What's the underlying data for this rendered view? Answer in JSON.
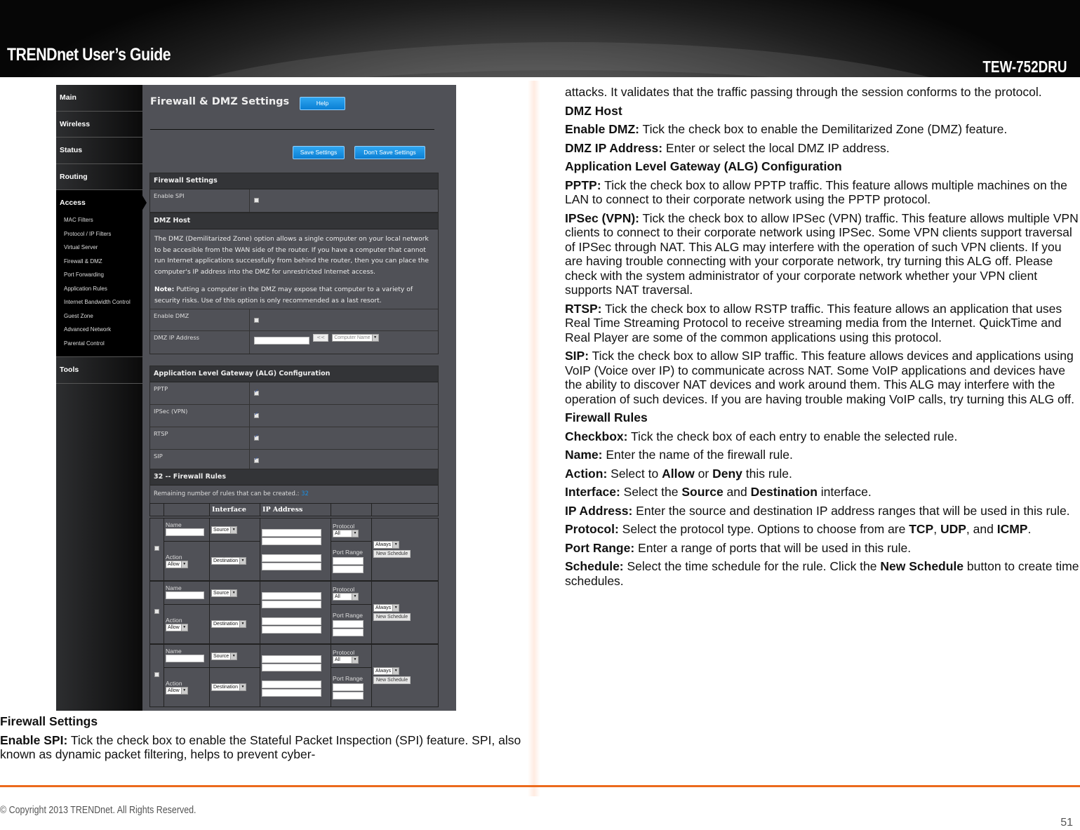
{
  "header": {
    "guide_title": "TRENDnet User’s Guide",
    "model": "TEW-752DRU"
  },
  "router_ui": {
    "sidebar": {
      "items": [
        "Main",
        "Wireless",
        "Status",
        "Routing"
      ],
      "active_section": "Access",
      "sub_items": [
        "MAC Filters",
        "Protocol / IP Filters",
        "Virtual Server",
        "Firewall & DMZ",
        "Port Forwarding",
        "Application Rules",
        "Internet Bandwidth Control",
        "Guest Zone",
        "Advanced Network",
        "Parental Control"
      ],
      "last_item": "Tools"
    },
    "page_title": "Firewall & DMZ Settings",
    "help_label": "Help",
    "save_label": "Save Settings",
    "dont_save_label": "Don't Save Settings",
    "firewall_settings": {
      "heading": "Firewall Settings",
      "enable_spi_label": "Enable SPI",
      "enable_spi_checked": false
    },
    "dmz_host": {
      "heading": "DMZ Host",
      "description": "The DMZ (Demilitarized Zone) option allows a single computer on your local network to be accesible from the WAN side of the router. If you have a computer that cannot run Internet applications successfully from behind the router, then you can place the computer's IP address into the DMZ for unrestricted Internet access.",
      "note_label": "Note:",
      "note_text": " Putting a computer in the DMZ may expose that computer to a variety of security risks. Use of this option is only recommended as a last resort.",
      "enable_dmz_label": "Enable DMZ",
      "enable_dmz_checked": false,
      "ip_label": "DMZ IP Address",
      "ip_value": "",
      "copy_button": "<<",
      "computer_name_placeholder": "Computer Name"
    },
    "alg": {
      "heading": "Application Level Gateway (ALG) Configuration",
      "rows": [
        {
          "label": "PPTP",
          "checked": true
        },
        {
          "label": "IPSec (VPN)",
          "checked": true
        },
        {
          "label": "RTSP",
          "checked": true
        },
        {
          "label": "SIP",
          "checked": true
        }
      ]
    },
    "firewall_rules": {
      "heading": "32 -- Firewall Rules",
      "remaining_label": "Remaining number of rules that can be created.:",
      "remaining_count": "32",
      "columns": [
        "",
        "",
        "Interface",
        "IP Address",
        "",
        ""
      ],
      "name_label": "Name",
      "action_label": "Action",
      "action_value": "Allow",
      "source_value": "Source",
      "destination_value": "Destination",
      "protocol_label": "Protocol",
      "protocol_value": "All",
      "port_range_label": "Port Range",
      "schedule_value": "Always",
      "new_schedule_label": "New Schedule",
      "rules_shown": 3
    },
    "accent_color": "#1a8fe3"
  },
  "left_text": {
    "heading": "Firewall Settings",
    "enable_spi_term": "Enable SPI:",
    "enable_spi_text": " Tick the check box to enable the Stateful Packet Inspection (SPI) feature. SPI, also known as dynamic packet filtering, helps to prevent cyber-"
  },
  "right_text": {
    "continuation": "attacks. It validates that the traffic passing through the session conforms to the protocol.",
    "dmz_heading": "DMZ Host",
    "enable_dmz_term": "Enable DMZ:",
    "enable_dmz_text": " Tick the check box to enable the Demilitarized Zone (DMZ) feature.",
    "dmz_ip_term": "DMZ IP Address:",
    "dmz_ip_text": " Enter or select the local DMZ IP address.",
    "alg_heading": "Application Level Gateway (ALG) Configuration",
    "pptp_term": "PPTP:",
    "pptp_text": " Tick the check box to allow PPTP traffic. This feature allows multiple machines on the LAN to connect to their corporate network using the PPTP protocol.",
    "ipsec_term": "IPSec (VPN):",
    "ipsec_text": " Tick the check box to allow IPSec (VPN) traffic. This feature allows multiple VPN clients to connect to their corporate network using IPSec. Some VPN clients support traversal of IPSec through NAT. This ALG may interfere with the operation of such VPN clients. If you are having trouble connecting with your corporate network, try turning this ALG off. Please check with the system administrator of your corporate network whether your VPN client supports NAT traversal.",
    "rtsp_term": "RTSP:",
    "rtsp_text": " Tick the check box to allow RSTP traffic. This feature allows an application that uses Real Time Streaming Protocol to receive streaming media from the Internet. QuickTime and Real Player are some of the common applications using this protocol.",
    "sip_term": "SIP:",
    "sip_text": " Tick the check box to allow SIP traffic. This feature allows devices and applications using VoIP (Voice over IP) to communicate across NAT. Some VoIP applications and devices have the ability to discover NAT devices and work around them. This ALG may interfere with the operation of such devices. If you are having trouble making VoIP calls, try turning this ALG off.",
    "rules_heading": "Firewall Rules",
    "checkbox_term": "Checkbox:",
    "checkbox_text": " Tick the check box of each entry to enable the selected rule.",
    "name_term": "Name:",
    "name_text": " Enter the name of the firewall rule.",
    "action_term": "Action:",
    "action_text_1": " Select to ",
    "action_allow": "Allow",
    "action_text_2": " or ",
    "action_deny": "Deny",
    "action_text_3": " this rule.",
    "interface_term": "Interface:",
    "interface_text_1": " Select the ",
    "interface_source": "Source",
    "interface_text_2": " and ",
    "interface_destination": "Destination",
    "interface_text_3": " interface.",
    "ip_term": "IP Address:",
    "ip_text": " Enter the source and destination IP address ranges that will be used in this rule.",
    "protocol_term": "Protocol:",
    "protocol_text": " Select the protocol type. Options to choose from are ",
    "protocol_tcp": "TCP",
    "protocol_sep1": ", ",
    "protocol_udp": "UDP",
    "protocol_sep2": ", and ",
    "protocol_icmp": "ICMP",
    "protocol_end": ".",
    "port_term": "Port Range:",
    "port_text": " Enter a range of ports that will be used in this rule.",
    "schedule_term": "Schedule:",
    "schedule_text_1": " Select the time schedule for the rule. Click the ",
    "schedule_button": "New Schedule",
    "schedule_text_2": " button to create time schedules."
  },
  "footer": {
    "copyright": "© Copyright 2013 TRENDnet. All Rights Reserved.",
    "page_number": "51",
    "accent_color": "#ec6a1c"
  }
}
